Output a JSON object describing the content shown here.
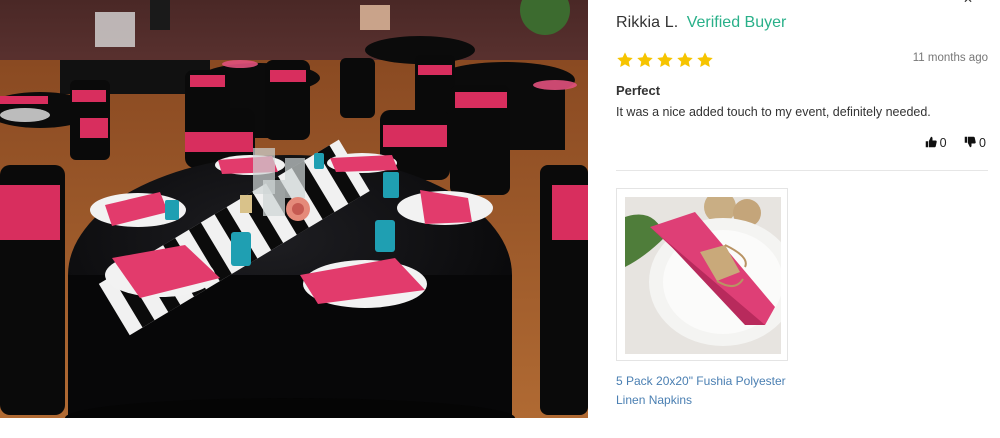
{
  "review": {
    "reviewer_name": "Rikkia L.",
    "verified_label": "Verified Buyer",
    "rating": 5,
    "rating_max": 5,
    "star_color": "#f6c400",
    "date": "11 months ago",
    "title": "Perfect",
    "body": "It was a nice added touch to my event, definitely needed.",
    "helpful_up_count": "0",
    "helpful_down_count": "0"
  },
  "product": {
    "name": "5 Pack 20x20\" Fushia Polyester Linen Napkins",
    "link_color": "#4a7fb2"
  },
  "icons": {
    "close": "close-icon",
    "thumbs_up": "thumbs-up-icon",
    "thumbs_down": "thumbs-down-icon",
    "star": "star-icon"
  },
  "colors": {
    "verified": "#29b089",
    "fuchsia": "#e0346b",
    "tablecloth": "#0e0e10"
  }
}
